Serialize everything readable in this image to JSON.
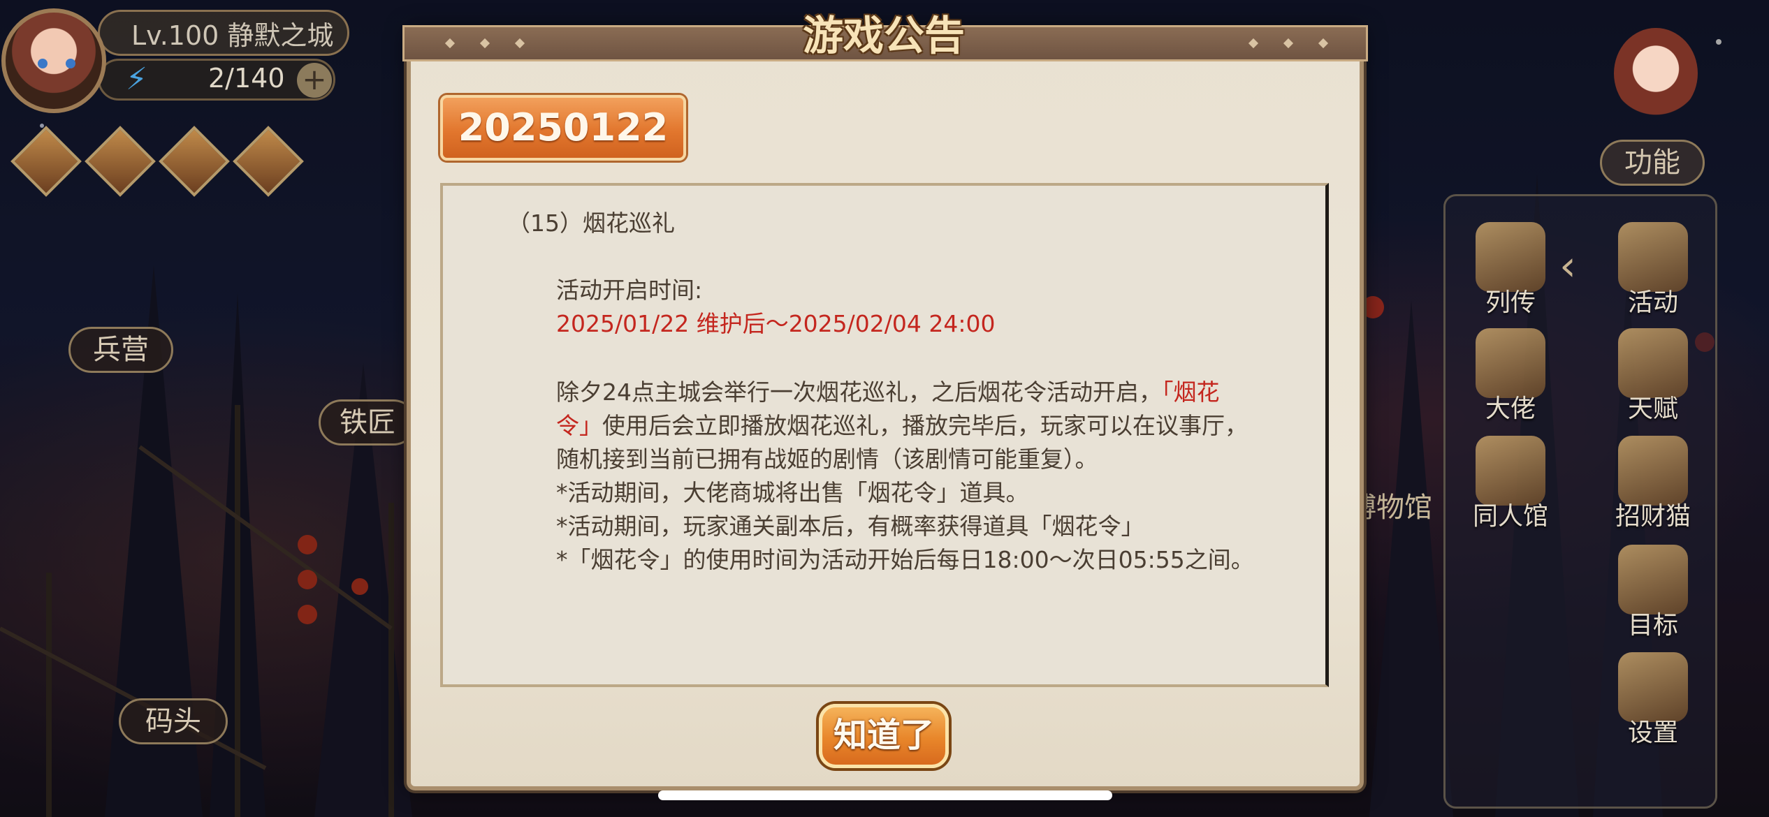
{
  "hud": {
    "level_text": "Lv.100  静默之城",
    "energy_text": "2/140",
    "plus_label": "+"
  },
  "map_labels": {
    "barracks": "兵营",
    "blacksmith": "铁匠",
    "dock": "码头",
    "museum": "博物馆"
  },
  "side_menu": {
    "function_label": "功能",
    "items": [
      "列传",
      "活动",
      "大佬",
      "天赋",
      "同人馆",
      "招财猫",
      "目标",
      "设置"
    ]
  },
  "dialog": {
    "title": "游戏公告",
    "date_tab": "20250122",
    "heading": "（15）烟花巡礼",
    "time_label": "活动开启时间:",
    "time_range": "2025/01/22 维护后～2025/02/04 24:00",
    "body_line1_a": "除夕24点主城会举行一次烟花巡礼，之后烟花令活动开启，",
    "body_line1_red": "「烟花",
    "body_line2_red": "令」",
    "body_line2_b": "使用后会立即播放烟花巡礼，播放完毕后，玩家可以在议事厅，",
    "body_line3": "随机接到当前已拥有战姬的剧情（该剧情可能重复）。",
    "note1": "*活动期间，大佬商城将出售「烟花令」道具。",
    "note2": "*活动期间，玩家通关副本后，有概率获得道具「烟花令」",
    "note3": "*「烟花令」的使用时间为活动开始后每日18:00～次日05:55之间。",
    "confirm_button": "知道了"
  },
  "colors": {
    "accent_orange": "#e2772e",
    "highlight_red": "#c4261e",
    "panel_bg": "#e8e2d6",
    "text_brown": "#4a3e32"
  }
}
